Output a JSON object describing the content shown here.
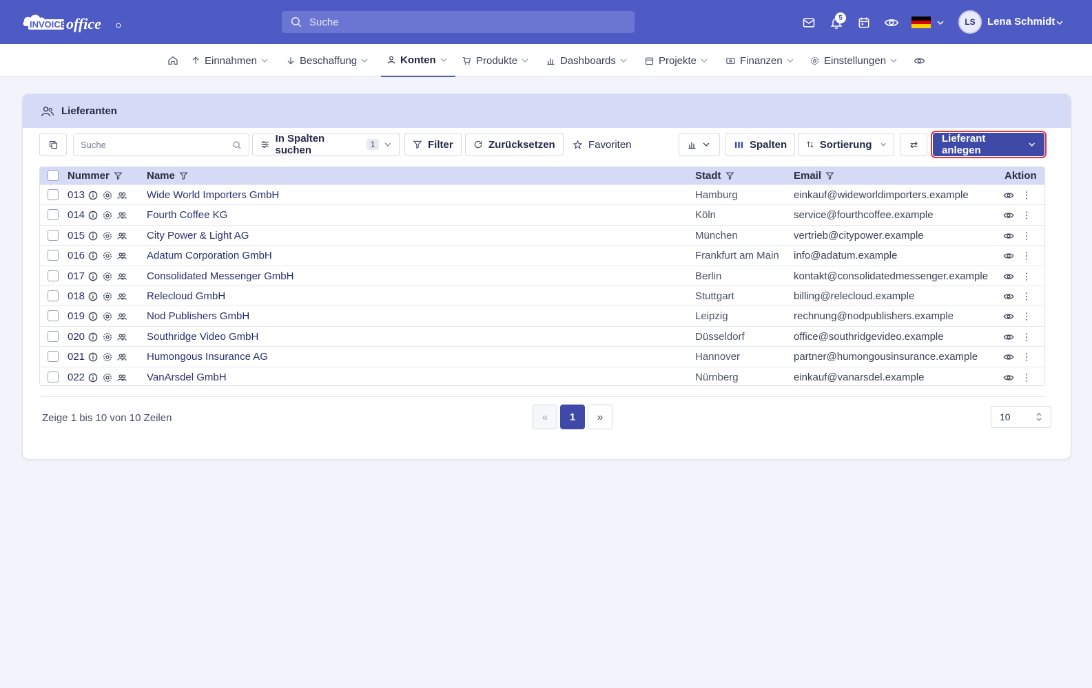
{
  "topbar": {
    "logo_text": "INVOICEoffice",
    "search_placeholder": "Suche",
    "notification_count": "5",
    "user_initials": "LS",
    "user_name": "Lena Schmidt"
  },
  "nav": {
    "items": [
      {
        "label": "Einnahmen"
      },
      {
        "label": "Beschaffung"
      },
      {
        "label": "Konten"
      },
      {
        "label": "Produkte"
      },
      {
        "label": "Dashboards"
      },
      {
        "label": "Projekte"
      },
      {
        "label": "Finanzen"
      },
      {
        "label": "Einstellungen"
      }
    ]
  },
  "card": {
    "title": "Lieferanten"
  },
  "toolbar": {
    "search_placeholder": "Suche",
    "search_in_columns_label": "In Spalten suchen",
    "search_in_columns_count": "1",
    "filter_label": "Filter",
    "reset_label": "Zurücksetzen",
    "favorites_label": "Favoriten",
    "columns_label": "Spalten",
    "sort_label": "Sortierung",
    "create_label": "Lieferant anlegen"
  },
  "table": {
    "headers": {
      "number": "Nummer",
      "name": "Name",
      "city": "Stadt",
      "email": "Email",
      "action": "Aktion"
    },
    "rows": [
      {
        "number": "013",
        "name": "Wide World Importers GmbH",
        "city": "Hamburg",
        "email": "einkauf@wideworldimporters.example"
      },
      {
        "number": "014",
        "name": "Fourth Coffee KG",
        "city": "Köln",
        "email": "service@fourthcoffee.example"
      },
      {
        "number": "015",
        "name": "City Power & Light AG",
        "city": "München",
        "email": "vertrieb@citypower.example"
      },
      {
        "number": "016",
        "name": "Adatum Corporation GmbH",
        "city": "Frankfurt am Main",
        "email": "info@adatum.example"
      },
      {
        "number": "017",
        "name": "Consolidated Messenger GmbH",
        "city": "Berlin",
        "email": "kontakt@consolidatedmessenger.example"
      },
      {
        "number": "018",
        "name": "Relecloud GmbH",
        "city": "Stuttgart",
        "email": "billing@relecloud.example"
      },
      {
        "number": "019",
        "name": "Nod Publishers GmbH",
        "city": "Leipzig",
        "email": "rechnung@nodpublishers.example"
      },
      {
        "number": "020",
        "name": "Southridge Video GmbH",
        "city": "Düsseldorf",
        "email": "office@southridgevideo.example"
      },
      {
        "number": "021",
        "name": "Humongous Insurance AG",
        "city": "Hannover",
        "email": "partner@humongousinsurance.example"
      },
      {
        "number": "022",
        "name": "VanArsdel GmbH",
        "city": "Nürnberg",
        "email": "einkauf@vanarsdel.example"
      }
    ]
  },
  "footer": {
    "summary": "Zeige 1 bis 10 von 10 Zeilen",
    "prev_label": "«",
    "current_page": "1",
    "next_label": "»",
    "page_size": "10"
  },
  "colors": {
    "topbar": "#4f5bc4",
    "primary_button": "#3f4aa8",
    "header_tint": "#d5daf6"
  }
}
